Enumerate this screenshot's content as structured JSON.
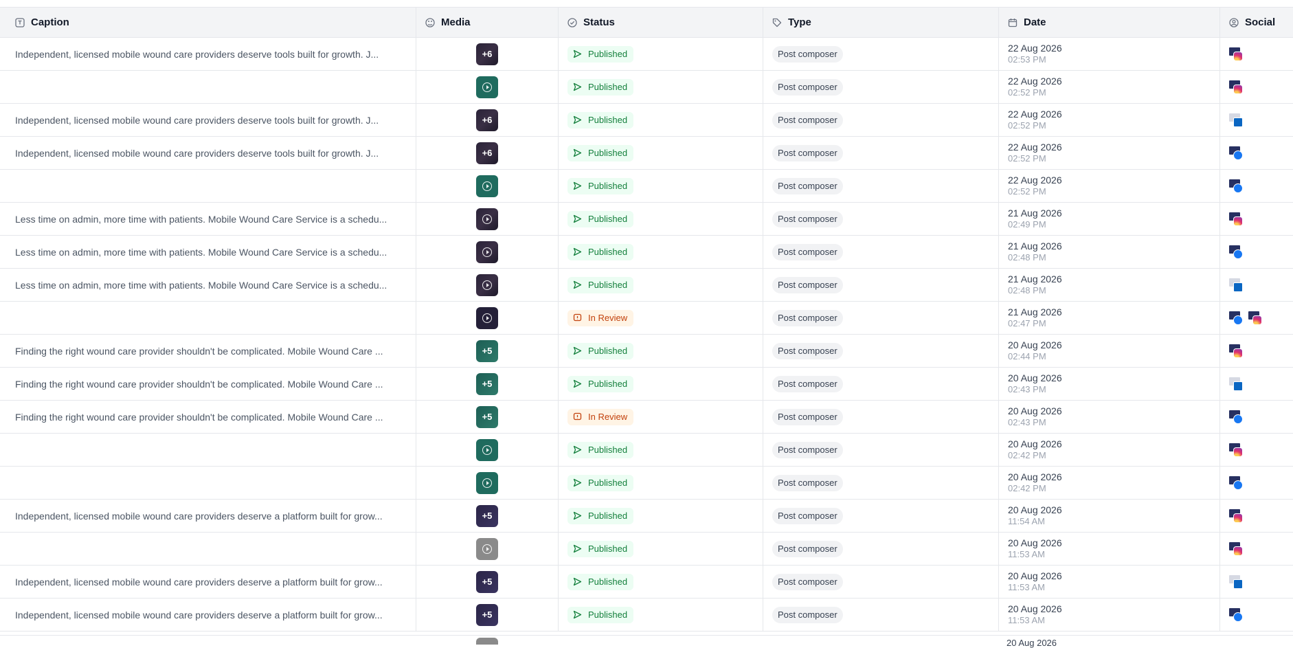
{
  "columns": {
    "caption": "Caption",
    "media": "Media",
    "status": "Status",
    "type": "Type",
    "date": "Date",
    "social": "Social"
  },
  "rows": [
    {
      "caption": "Independent, licensed mobile wound care providers deserve tools built for growth. J...",
      "media": {
        "kind": "dark",
        "more": "+6"
      },
      "status": {
        "label": "Published",
        "kind": "pub"
      },
      "type": "Post composer",
      "date": "22 Aug 2026",
      "time": "02:53 PM",
      "social": [
        "ig"
      ]
    },
    {
      "caption": "",
      "media": {
        "kind": "green",
        "more": ""
      },
      "status": {
        "label": "Published",
        "kind": "pub"
      },
      "type": "Post composer",
      "date": "22 Aug 2026",
      "time": "02:52 PM",
      "social": [
        "ig"
      ]
    },
    {
      "caption": "Independent, licensed mobile wound care providers deserve tools built for growth. J...",
      "media": {
        "kind": "dark",
        "more": "+6"
      },
      "status": {
        "label": "Published",
        "kind": "pub"
      },
      "type": "Post composer",
      "date": "22 Aug 2026",
      "time": "02:52 PM",
      "social": [
        "li"
      ]
    },
    {
      "caption": "Independent, licensed mobile wound care providers deserve tools built for growth. J...",
      "media": {
        "kind": "dark",
        "more": "+6"
      },
      "status": {
        "label": "Published",
        "kind": "pub"
      },
      "type": "Post composer",
      "date": "22 Aug 2026",
      "time": "02:52 PM",
      "social": [
        "fb"
      ]
    },
    {
      "caption": "",
      "media": {
        "kind": "green",
        "more": ""
      },
      "status": {
        "label": "Published",
        "kind": "pub"
      },
      "type": "Post composer",
      "date": "22 Aug 2026",
      "time": "02:52 PM",
      "social": [
        "fb"
      ]
    },
    {
      "caption": "Less time on admin, more time with patients. Mobile Wound Care Service is a schedu...",
      "media": {
        "kind": "dark",
        "more": ""
      },
      "status": {
        "label": "Published",
        "kind": "pub"
      },
      "type": "Post composer",
      "date": "21 Aug 2026",
      "time": "02:49 PM",
      "social": [
        "ig"
      ]
    },
    {
      "caption": "Less time on admin, more time with patients. Mobile Wound Care Service is a schedu...",
      "media": {
        "kind": "dark",
        "more": ""
      },
      "status": {
        "label": "Published",
        "kind": "pub"
      },
      "type": "Post composer",
      "date": "21 Aug 2026",
      "time": "02:48 PM",
      "social": [
        "fb"
      ]
    },
    {
      "caption": "Less time on admin, more time with patients. Mobile Wound Care Service is a schedu...",
      "media": {
        "kind": "dark",
        "more": ""
      },
      "status": {
        "label": "Published",
        "kind": "pub"
      },
      "type": "Post composer",
      "date": "21 Aug 2026",
      "time": "02:48 PM",
      "social": [
        "li"
      ]
    },
    {
      "caption": "",
      "media": {
        "kind": "navy",
        "more": ""
      },
      "status": {
        "label": "In Review",
        "kind": "rev"
      },
      "type": "Post composer",
      "date": "21 Aug 2026",
      "time": "02:47 PM",
      "social": [
        "fb",
        "ig"
      ]
    },
    {
      "caption": "Finding the right wound care provider shouldn't be complicated. Mobile Wound Care ...",
      "media": {
        "kind": "teal",
        "more": "+5"
      },
      "status": {
        "label": "Published",
        "kind": "pub"
      },
      "type": "Post composer",
      "date": "20 Aug 2026",
      "time": "02:44 PM",
      "social": [
        "ig"
      ]
    },
    {
      "caption": "Finding the right wound care provider shouldn't be complicated. Mobile Wound Care ...",
      "media": {
        "kind": "teal",
        "more": "+5"
      },
      "status": {
        "label": "Published",
        "kind": "pub"
      },
      "type": "Post composer",
      "date": "20 Aug 2026",
      "time": "02:43 PM",
      "social": [
        "li"
      ]
    },
    {
      "caption": "Finding the right wound care provider shouldn't be complicated. Mobile Wound Care ...",
      "media": {
        "kind": "teal",
        "more": "+5"
      },
      "status": {
        "label": "In Review",
        "kind": "rev"
      },
      "type": "Post composer",
      "date": "20 Aug 2026",
      "time": "02:43 PM",
      "social": [
        "fb"
      ]
    },
    {
      "caption": "",
      "media": {
        "kind": "green",
        "more": ""
      },
      "status": {
        "label": "Published",
        "kind": "pub"
      },
      "type": "Post composer",
      "date": "20 Aug 2026",
      "time": "02:42 PM",
      "social": [
        "ig"
      ]
    },
    {
      "caption": "",
      "media": {
        "kind": "green",
        "more": ""
      },
      "status": {
        "label": "Published",
        "kind": "pub"
      },
      "type": "Post composer",
      "date": "20 Aug 2026",
      "time": "02:42 PM",
      "social": [
        "fb"
      ]
    },
    {
      "caption": "Independent, licensed mobile wound care providers deserve a platform built for grow...",
      "media": {
        "kind": "purple",
        "more": "+5"
      },
      "status": {
        "label": "Published",
        "kind": "pub"
      },
      "type": "Post composer",
      "date": "20 Aug 2026",
      "time": "11:54 AM",
      "social": [
        "ig"
      ]
    },
    {
      "caption": "",
      "media": {
        "kind": "gray",
        "more": ""
      },
      "status": {
        "label": "Published",
        "kind": "pub"
      },
      "type": "Post composer",
      "date": "20 Aug 2026",
      "time": "11:53 AM",
      "social": [
        "ig"
      ]
    },
    {
      "caption": "Independent, licensed mobile wound care providers deserve a platform built for grow...",
      "media": {
        "kind": "purple",
        "more": "+5"
      },
      "status": {
        "label": "Published",
        "kind": "pub"
      },
      "type": "Post composer",
      "date": "20 Aug 2026",
      "time": "11:53 AM",
      "social": [
        "li"
      ]
    },
    {
      "caption": "Independent, licensed mobile wound care providers deserve a platform built for grow...",
      "media": {
        "kind": "purple",
        "more": "+5"
      },
      "status": {
        "label": "Published",
        "kind": "pub"
      },
      "type": "Post composer",
      "date": "20 Aug 2026",
      "time": "11:53 AM",
      "social": [
        "fb"
      ]
    }
  ],
  "partial_row": {
    "date": "20 Aug 2026"
  },
  "colors": {
    "published_text": "#15803d",
    "published_bg": "#ecfdf3",
    "review_text": "#c2410c",
    "review_bg": "#fff4e5"
  }
}
